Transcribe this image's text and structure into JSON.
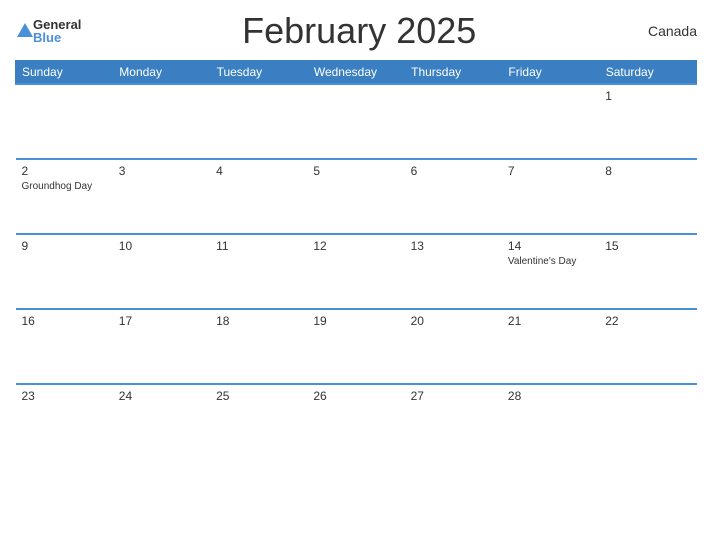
{
  "header": {
    "logo_general": "General",
    "logo_blue": "Blue",
    "title": "February 2025",
    "country": "Canada"
  },
  "days_of_week": [
    "Sunday",
    "Monday",
    "Tuesday",
    "Wednesday",
    "Thursday",
    "Friday",
    "Saturday"
  ],
  "weeks": [
    [
      {
        "day": "",
        "event": "",
        "empty": true
      },
      {
        "day": "",
        "event": "",
        "empty": true
      },
      {
        "day": "",
        "event": "",
        "empty": true
      },
      {
        "day": "",
        "event": "",
        "empty": true
      },
      {
        "day": "",
        "event": "",
        "empty": true
      },
      {
        "day": "",
        "event": "",
        "empty": true
      },
      {
        "day": "1",
        "event": ""
      }
    ],
    [
      {
        "day": "2",
        "event": "Groundhog Day"
      },
      {
        "day": "3",
        "event": ""
      },
      {
        "day": "4",
        "event": ""
      },
      {
        "day": "5",
        "event": ""
      },
      {
        "day": "6",
        "event": ""
      },
      {
        "day": "7",
        "event": ""
      },
      {
        "day": "8",
        "event": ""
      }
    ],
    [
      {
        "day": "9",
        "event": ""
      },
      {
        "day": "10",
        "event": ""
      },
      {
        "day": "11",
        "event": ""
      },
      {
        "day": "12",
        "event": ""
      },
      {
        "day": "13",
        "event": ""
      },
      {
        "day": "14",
        "event": "Valentine's Day"
      },
      {
        "day": "15",
        "event": ""
      }
    ],
    [
      {
        "day": "16",
        "event": ""
      },
      {
        "day": "17",
        "event": ""
      },
      {
        "day": "18",
        "event": ""
      },
      {
        "day": "19",
        "event": ""
      },
      {
        "day": "20",
        "event": ""
      },
      {
        "day": "21",
        "event": ""
      },
      {
        "day": "22",
        "event": ""
      }
    ],
    [
      {
        "day": "23",
        "event": ""
      },
      {
        "day": "24",
        "event": ""
      },
      {
        "day": "25",
        "event": ""
      },
      {
        "day": "26",
        "event": ""
      },
      {
        "day": "27",
        "event": ""
      },
      {
        "day": "28",
        "event": ""
      },
      {
        "day": "",
        "event": "",
        "empty": true
      }
    ]
  ]
}
